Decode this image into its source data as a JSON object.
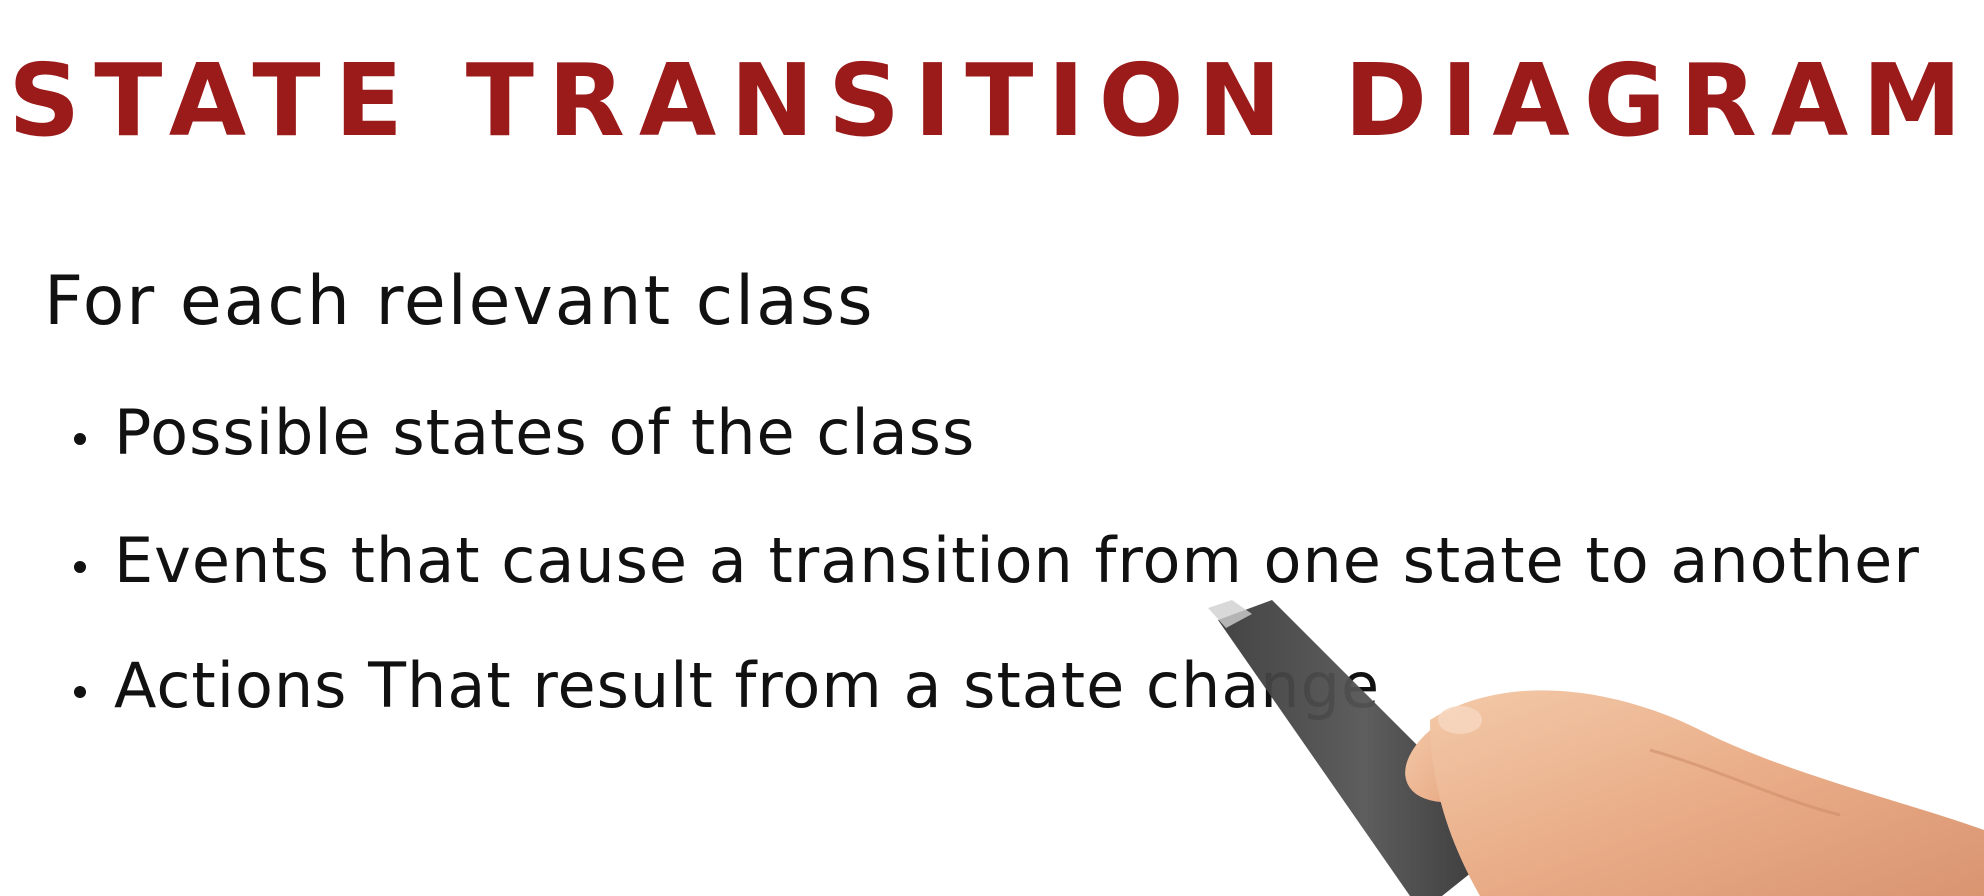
{
  "title": "STATE TRANSITION DIAGRAM",
  "intro": "For each relevant class",
  "bullets": [
    "Possible states of the class",
    "Events that cause a transition from one state to another",
    "Actions That result from a state change"
  ],
  "colors": {
    "title": "#9b1a1a",
    "text": "#111111",
    "background": "#ffffff"
  }
}
